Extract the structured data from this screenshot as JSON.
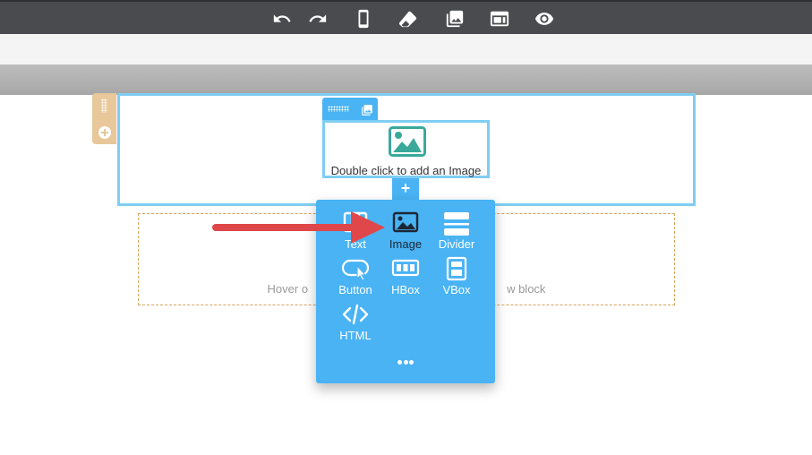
{
  "toolbar": {
    "icons": [
      "undo-icon",
      "redo-icon",
      "mobile-view-icon",
      "eraser-icon",
      "image-gallery-icon",
      "layout-icon",
      "preview-eye-icon"
    ]
  },
  "canvas": {
    "image_cell": {
      "caption": "Double click to add an Image"
    },
    "add_button": {
      "label": "+"
    },
    "empty_block": {
      "hint_left": "Hover o",
      "hint_right": "w block"
    }
  },
  "block_menu": {
    "items": [
      {
        "label": "Text",
        "icon": "text-columns-icon"
      },
      {
        "label": "Image",
        "icon": "image-icon",
        "highlighted": true
      },
      {
        "label": "Divider",
        "icon": "divider-icon"
      },
      {
        "label": "Button",
        "icon": "button-icon"
      },
      {
        "label": "HBox",
        "icon": "hbox-icon"
      },
      {
        "label": "VBox",
        "icon": "vbox-icon"
      },
      {
        "label": "HTML",
        "icon": "html-code-icon"
      }
    ],
    "more_icon": "more-dots-icon"
  },
  "colors": {
    "toolbar_bg": "#4a4b4f",
    "accent_blue": "#49b3f4",
    "selection_border": "#7fcdf2",
    "handle": "#e8c79a",
    "arrow_red": "#e0474a",
    "image_placeholder": "#3aa99b"
  }
}
